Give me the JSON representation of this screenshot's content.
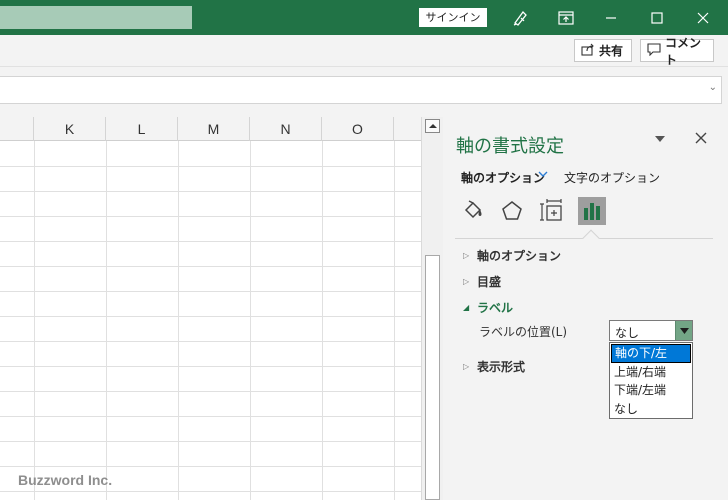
{
  "titlebar": {
    "signin_label": "サインイン",
    "icons": [
      "pen-icon",
      "ribbon-display-icon",
      "minimize-icon",
      "maximize-icon",
      "close-icon"
    ]
  },
  "ribbon": {
    "share_label": "共有",
    "comment_label": "コメント"
  },
  "grid": {
    "columns": [
      "K",
      "L",
      "M",
      "N",
      "O"
    ],
    "watermark": "Buzzword Inc."
  },
  "pane": {
    "title": "軸の書式設定",
    "tabs": {
      "axis_options": "軸のオプション",
      "text_options": "文字のオプション"
    },
    "sections": {
      "axis_options": "軸のオプション",
      "tick_marks": "目盛",
      "labels": "ラベル",
      "number_format": "表示形式"
    },
    "label_position": {
      "label": "ラベルの位置(L)",
      "value": "なし",
      "options": [
        "軸の下/左",
        "上端/右端",
        "下端/左端",
        "なし"
      ],
      "highlighted_option": "軸の下/左"
    }
  },
  "colors": {
    "accent": "#217346",
    "selection": "#0078d7"
  }
}
